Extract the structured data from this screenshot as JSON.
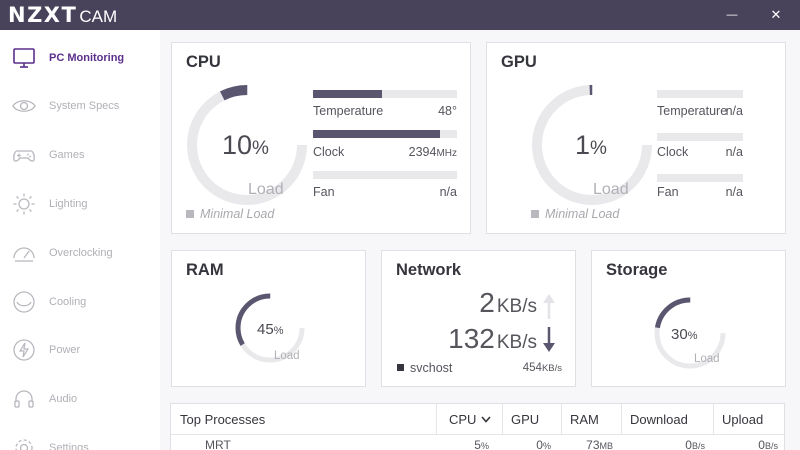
{
  "app": {
    "logo_main": "NZXT",
    "logo_sub": "CAM",
    "minimize_glyph": "—",
    "close_glyph": "✕"
  },
  "sidebar": {
    "items": [
      {
        "label": "PC Monitoring",
        "icon": "monitor-icon",
        "active": true
      },
      {
        "label": "System Specs",
        "icon": "eye-icon"
      },
      {
        "label": "Games",
        "icon": "gamepad-icon"
      },
      {
        "label": "Lighting",
        "icon": "sun-icon"
      },
      {
        "label": "Overclocking",
        "icon": "speedometer-icon"
      },
      {
        "label": "Cooling",
        "icon": "fan-icon"
      },
      {
        "label": "Power",
        "icon": "lightning-icon"
      },
      {
        "label": "Audio",
        "icon": "headphones-icon"
      },
      {
        "label": "Settings",
        "icon": "gear-icon"
      }
    ]
  },
  "cpu": {
    "title": "CPU",
    "load_value": "10",
    "load_unit": "%",
    "load_fraction": 0.1,
    "load_label": "Load",
    "legend": "Minimal Load",
    "temperature_label": "Temperature",
    "temperature_value": "48°",
    "temperature_fraction": 0.48,
    "clock_label": "Clock",
    "clock_value": "2394",
    "clock_unit": "MHz",
    "clock_fraction": 0.88,
    "fan_label": "Fan",
    "fan_value": "n/a"
  },
  "gpu": {
    "title": "GPU",
    "load_value": "1",
    "load_unit": "%",
    "load_fraction": 0.01,
    "load_label": "Load",
    "legend": "Minimal Load",
    "temperature_label": "Temperature",
    "temperature_value": "n/a",
    "clock_label": "Clock",
    "clock_value": "n/a",
    "fan_label": "Fan",
    "fan_value": "n/a"
  },
  "ram": {
    "title": "RAM",
    "load_value": "45",
    "load_unit": "%",
    "load_fraction": 0.45,
    "load_label": "Load"
  },
  "network": {
    "title": "Network",
    "up_value": "2",
    "up_unit": "KB/s",
    "down_value": "132",
    "down_unit": "KB/s",
    "process_name": "svchost",
    "process_value": "454",
    "process_unit": "KB/s"
  },
  "storage": {
    "title": "Storage",
    "load_value": "30",
    "load_unit": "%",
    "load_fraction": 0.3,
    "load_label": "Load"
  },
  "processes": {
    "columns": [
      "Top Processes",
      "CPU",
      "GPU",
      "RAM",
      "Download",
      "Upload"
    ],
    "rows": [
      {
        "name": "MRT",
        "cpu": "5",
        "cpu_unit": "%",
        "gpu": "0",
        "gpu_unit": "%",
        "ram": "73",
        "ram_unit": "MB",
        "download": "0",
        "download_unit": "B/s",
        "upload": "0",
        "upload_unit": "B/s"
      }
    ]
  },
  "colors": {
    "accent": "#5b2f8c",
    "titlebar": "#48435a",
    "gauge_fill": "#5a5670",
    "gauge_track": "#e9e9ec"
  }
}
